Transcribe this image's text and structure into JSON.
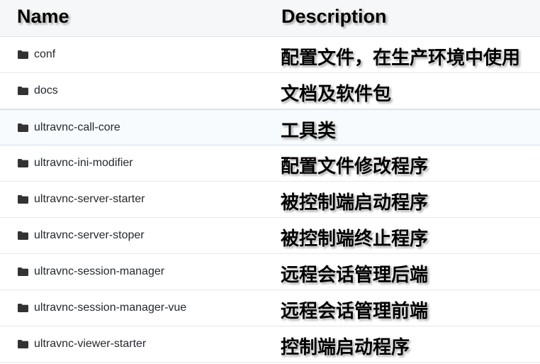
{
  "table": {
    "headers": {
      "name": "Name",
      "description": "Description"
    },
    "rows": [
      {
        "icon": "folder-icon",
        "name": "conf",
        "description": "配置文件，在生产环境中使用"
      },
      {
        "icon": "folder-icon",
        "name": "docs",
        "description": "文档及软件包"
      },
      {
        "icon": "folder-icon",
        "name": "ultravnc-call-core",
        "description": "工具类"
      },
      {
        "icon": "folder-icon",
        "name": "ultravnc-ini-modifier",
        "description": "配置文件修改程序"
      },
      {
        "icon": "folder-icon",
        "name": "ultravnc-server-starter",
        "description": "被控制端启动程序"
      },
      {
        "icon": "folder-icon",
        "name": "ultravnc-server-stoper",
        "description": "被控制端终止程序"
      },
      {
        "icon": "folder-icon",
        "name": "ultravnc-session-manager",
        "description": "远程会话管理后端"
      },
      {
        "icon": "folder-icon",
        "name": "ultravnc-session-manager-vue",
        "description": "远程会话管理前端"
      },
      {
        "icon": "folder-icon",
        "name": "ultravnc-viewer-starter",
        "description": "控制端启动程序"
      }
    ]
  },
  "colors": {
    "header_background": "#f6f7f8",
    "row_border": "#e5e7ea",
    "highlight_background": "#f8fbfd",
    "highlight_border": "#cfe0ee",
    "folder_icon": "#333333",
    "name_text": "#24292e"
  }
}
